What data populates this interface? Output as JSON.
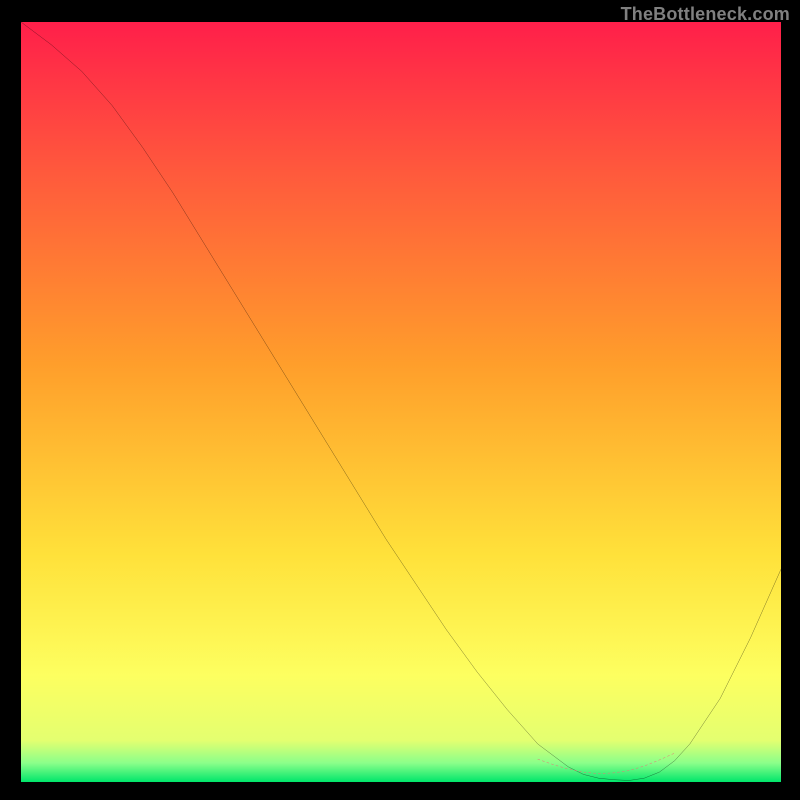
{
  "watermark": "TheBottleneck.com",
  "chart_data": {
    "type": "line",
    "title": "",
    "xlabel": "",
    "ylabel": "",
    "xlim": [
      0,
      100
    ],
    "ylim": [
      0,
      100
    ],
    "series": [
      {
        "name": "curve",
        "color": "#000000",
        "x": [
          0,
          4,
          8,
          12,
          16,
          20,
          24,
          28,
          32,
          36,
          40,
          44,
          48,
          52,
          56,
          60,
          64,
          68,
          70,
          72,
          74,
          76,
          78,
          80,
          82,
          84,
          86,
          88,
          92,
          96,
          100
        ],
        "y": [
          100,
          97,
          93.5,
          89,
          83.5,
          77.5,
          71,
          64.5,
          58,
          51.5,
          45,
          38.5,
          32,
          26,
          20,
          14.5,
          9.5,
          5,
          3.5,
          2,
          1,
          0.5,
          0.3,
          0.2,
          0.5,
          1.3,
          2.8,
          5,
          11,
          19,
          28
        ]
      },
      {
        "name": "highlight",
        "color": "#e77777",
        "style": "dashed",
        "x": [
          68,
          70,
          72,
          74,
          76,
          78,
          80,
          82,
          84,
          86
        ],
        "y": [
          3.0,
          2.3,
          1.7,
          1.3,
          1.1,
          1.2,
          1.5,
          2.1,
          2.9,
          3.8
        ]
      }
    ],
    "background_gradient": {
      "orientation": "vertical",
      "stops": [
        {
          "offset": 0.0,
          "color": "#ff1f4a"
        },
        {
          "offset": 0.2,
          "color": "#ff5a3c"
        },
        {
          "offset": 0.45,
          "color": "#ff9e2b"
        },
        {
          "offset": 0.7,
          "color": "#ffe13a"
        },
        {
          "offset": 0.86,
          "color": "#fdff60"
        },
        {
          "offset": 0.945,
          "color": "#e4ff70"
        },
        {
          "offset": 0.975,
          "color": "#8bff8a"
        },
        {
          "offset": 1.0,
          "color": "#00e66b"
        }
      ]
    }
  }
}
